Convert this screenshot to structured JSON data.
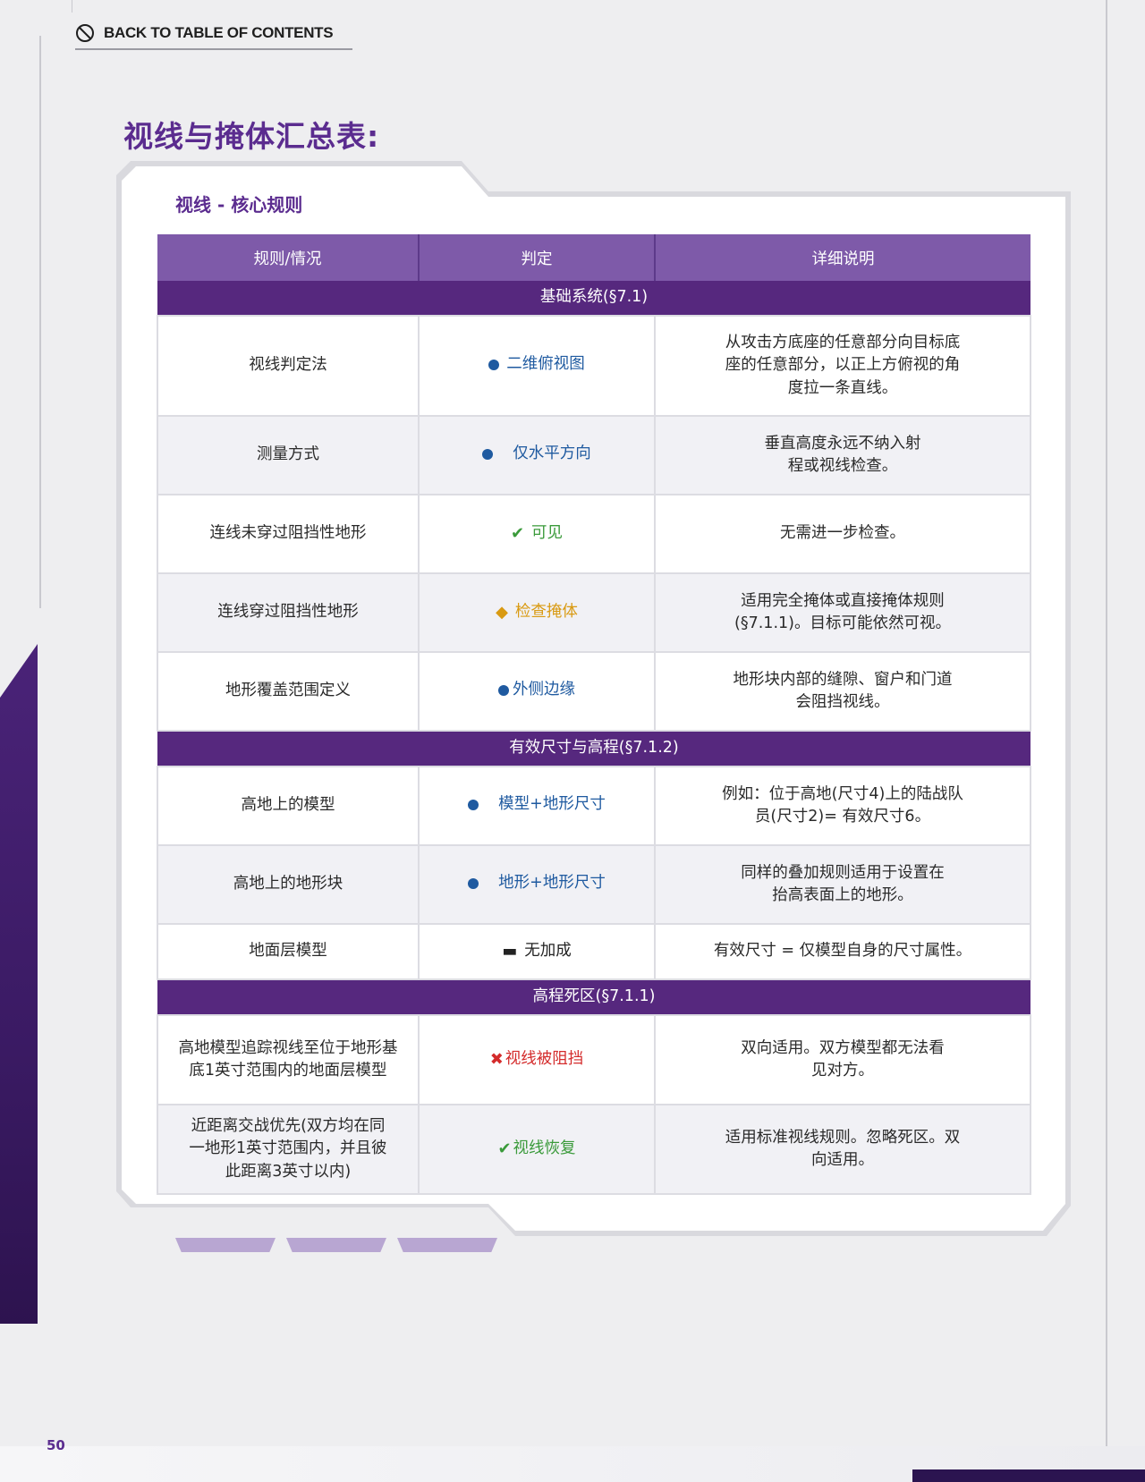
{
  "nav": {
    "back_label": "BACK TO TABLE OF CONTENTS"
  },
  "page_title": "视线与掩体汇总表:",
  "card": {
    "subtitle": "视线 - 核心规则"
  },
  "table": {
    "headers": [
      "规则/情况",
      "判定",
      "详细说明"
    ],
    "sections": [
      {
        "title": "基础系统(§7.1)",
        "rows": [
          {
            "rule": "视线判定法",
            "verdict": "二维俯视图",
            "verdict_icon": "blue-dot-icon",
            "detail": "从攻击方底座的任意部分向目标底座的任意部分，以正上方俯视的角度拉一条直线。"
          },
          {
            "rule": "测量方式",
            "verdict": "仅水平方向",
            "verdict_icon": "blue-dot-icon",
            "detail": "垂直高度永远不纳入射程或视线检查。"
          },
          {
            "rule": "连线未穿过阻挡性地形",
            "verdict": "可见",
            "verdict_icon": "green-check-icon",
            "detail": "无需进一步检查。"
          },
          {
            "rule": "连线穿过阻挡性地形",
            "verdict": "检查掩体",
            "verdict_icon": "amber-diamond-icon",
            "detail": "适用完全掩体或直接掩体规则(§7.1.1)。目标可能依然可视。"
          },
          {
            "rule": "地形覆盖范围定义",
            "verdict": "外侧边缘",
            "verdict_icon": "blue-dot-icon",
            "detail": "地形块内部的缝隙、窗户和门道会阻挡视线。"
          }
        ]
      },
      {
        "title": "有效尺寸与高程(§7.1.2)",
        "rows": [
          {
            "rule": "高地上的模型",
            "verdict": "模型+地形尺寸",
            "verdict_icon": "blue-dot-icon",
            "detail": "例如：位于高地(尺寸4)上的陆战队员(尺寸2)= 有效尺寸6。"
          },
          {
            "rule": "高地上的地形块",
            "verdict": "地形+地形尺寸",
            "verdict_icon": "blue-dot-icon",
            "detail": "同样的叠加规则适用于设置在抬高表面上的地形。"
          },
          {
            "rule": "地面层模型",
            "verdict": "无加成",
            "verdict_icon": "black-dash-icon",
            "detail": "有效尺寸 = 仅模型自身的尺寸属性。"
          }
        ]
      },
      {
        "title": "高程死区(§7.1.1)",
        "rows": [
          {
            "rule": "高地模型追踪视线至位于地形基底1英寸范围内的地面层模型",
            "verdict": "视线被阻挡",
            "verdict_icon": "red-cross-icon",
            "detail": "双向适用。双方模型都无法看见对方。"
          },
          {
            "rule": "近距离交战优先(双方均在同一地形1英寸范围内，并且彼此距离3英寸以内)",
            "verdict": "视线恢复",
            "verdict_icon": "green-check-icon",
            "detail": "适用标准视线规则。忽略死区。双向适用。"
          }
        ]
      }
    ]
  },
  "footer": {
    "page_number": "50"
  },
  "colors": {
    "accent": "#5b2c8f",
    "header": "#7e5aa9",
    "section": "#56287e",
    "blue": "#1f5aa0",
    "green": "#3a9a3a",
    "amber": "#d99a12",
    "red": "#d42b2b"
  }
}
